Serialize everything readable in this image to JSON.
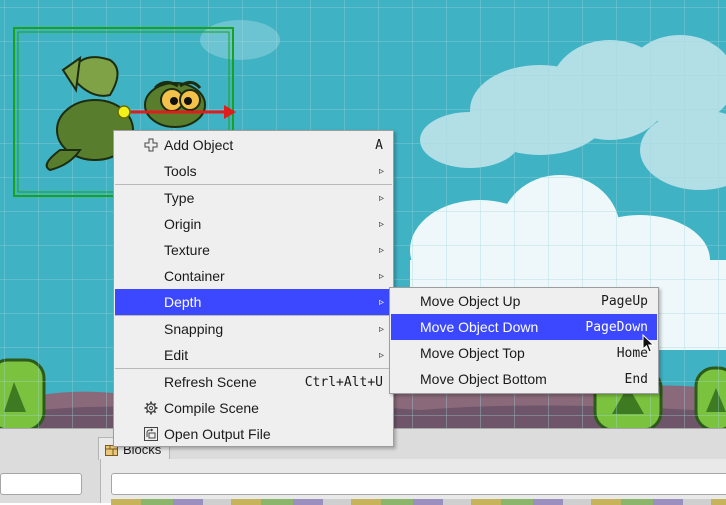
{
  "context_menu": {
    "items": [
      {
        "label": "Add Object",
        "shortcut": "A",
        "icon": "plus-crosshair-icon"
      },
      {
        "label": "Tools",
        "submenu": true
      },
      {
        "label": "Type",
        "submenu": true
      },
      {
        "label": "Origin",
        "submenu": true
      },
      {
        "label": "Texture",
        "submenu": true
      },
      {
        "label": "Container",
        "submenu": true
      },
      {
        "label": "Depth",
        "submenu": true,
        "highlighted": true
      },
      {
        "label": "Snapping",
        "submenu": true
      },
      {
        "label": "Edit",
        "submenu": true
      },
      {
        "label": "Refresh Scene",
        "shortcut": "Ctrl+Alt+U"
      },
      {
        "label": "Compile Scene",
        "icon": "gear-icon"
      },
      {
        "label": "Open Output File",
        "icon": "output-file-icon"
      }
    ],
    "submenu_arrow": "▹"
  },
  "depth_submenu": {
    "items": [
      {
        "label": "Move Object Up",
        "shortcut": "PageUp"
      },
      {
        "label": "Move Object Down",
        "shortcut": "PageDown",
        "highlighted": true
      },
      {
        "label": "Move Object Top",
        "shortcut": "Home"
      },
      {
        "label": "Move Object Bottom",
        "shortcut": "End"
      }
    ]
  },
  "dock": {
    "blocks_tab_label": "Blocks"
  },
  "colors": {
    "menu_highlight": "#3b48ff",
    "sky": "#44b7c8",
    "selection_outline": "#1aa31a",
    "x_axis_handle": "#e01c1c",
    "origin_handle": "#f2f21a"
  }
}
